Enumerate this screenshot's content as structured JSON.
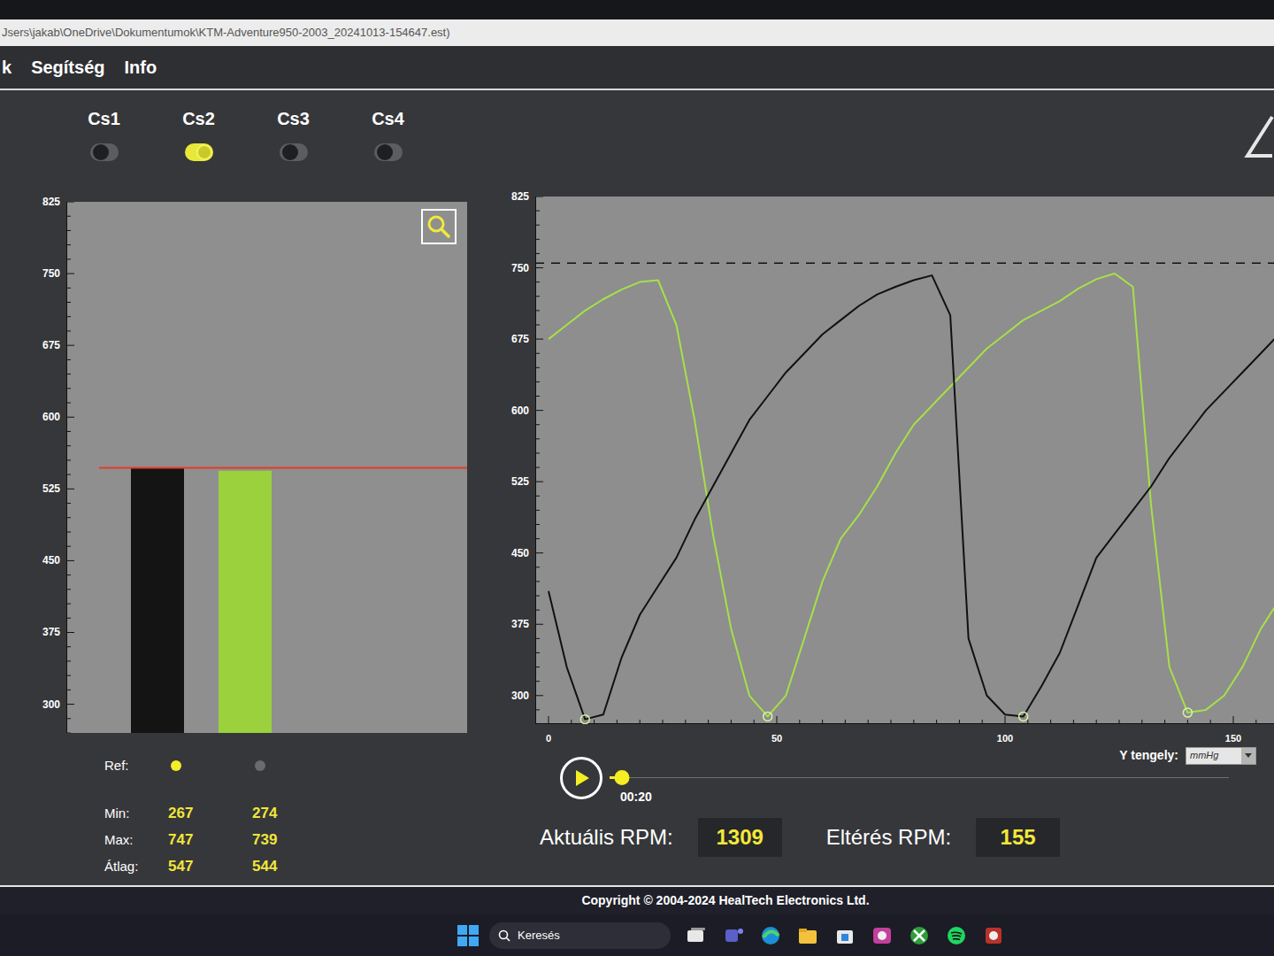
{
  "window": {
    "title": "Jsers\\jakab\\OneDrive\\Dokumentumok\\KTM-Adventure950-2003_20241013-154647.est)"
  },
  "menu": [
    {
      "label": "k"
    },
    {
      "label": "Segítség"
    },
    {
      "label": "Info"
    }
  ],
  "channels": [
    {
      "name": "Cs1",
      "on": false
    },
    {
      "name": "Cs2",
      "on": true
    },
    {
      "name": "Cs3",
      "on": false
    },
    {
      "name": "Cs4",
      "on": false
    }
  ],
  "bar_chart": {
    "y_ticks": [
      "825",
      "750",
      "675",
      "600",
      "525",
      "450",
      "375",
      "300"
    ],
    "ref_line": 547,
    "bars": [
      {
        "value": 547,
        "color": "#141414"
      },
      {
        "value": 544,
        "color": "#9ad13c"
      }
    ]
  },
  "ref": {
    "label": "Ref:",
    "columns": [
      {
        "selected": true
      },
      {
        "selected": false
      }
    ]
  },
  "stats": [
    {
      "label": "Min:",
      "values": [
        "267",
        "274"
      ]
    },
    {
      "label": "Max:",
      "values": [
        "747",
        "739"
      ]
    },
    {
      "label": "Átlag:",
      "values": [
        "547",
        "544"
      ]
    }
  ],
  "wave_chart": {
    "y_ticks": [
      "825",
      "750",
      "675",
      "600",
      "525",
      "450",
      "375",
      "300"
    ],
    "x_ticks": [
      "0",
      "50",
      "100",
      "150"
    ],
    "threshold": 755,
    "series": [
      {
        "color": "#a6e04a",
        "values": [
          675,
          690,
          705,
          717,
          727,
          735,
          737,
          690,
          590,
          470,
          370,
          300,
          278,
          300,
          360,
          420,
          465,
          490,
          520,
          555,
          585,
          605,
          625,
          645,
          665,
          680,
          695,
          705,
          715,
          728,
          738,
          744,
          730,
          500,
          330,
          282,
          285,
          300,
          330,
          370,
          400
        ]
      },
      {
        "color": "#111111",
        "values": [
          410,
          330,
          275,
          280,
          340,
          385,
          415,
          445,
          485,
          520,
          555,
          590,
          615,
          640,
          660,
          680,
          695,
          710,
          722,
          730,
          737,
          742,
          700,
          360,
          300,
          280,
          278,
          310,
          345,
          395,
          445,
          470,
          495,
          520,
          550,
          575,
          600,
          620,
          640,
          660,
          680
        ]
      }
    ]
  },
  "playback": {
    "time": "00:20",
    "level": 0.02
  },
  "y_axis": {
    "label": "Y tengely:",
    "unit": "mmHg"
  },
  "rpm": {
    "current_label": "Aktuális RPM:",
    "current": "1309",
    "deviation_label": "Eltérés RPM:",
    "deviation": "155"
  },
  "footer": "Copyright © 2004-2024 HealTech Electronics Ltd.",
  "taskbar": {
    "search": "Keresés"
  }
}
